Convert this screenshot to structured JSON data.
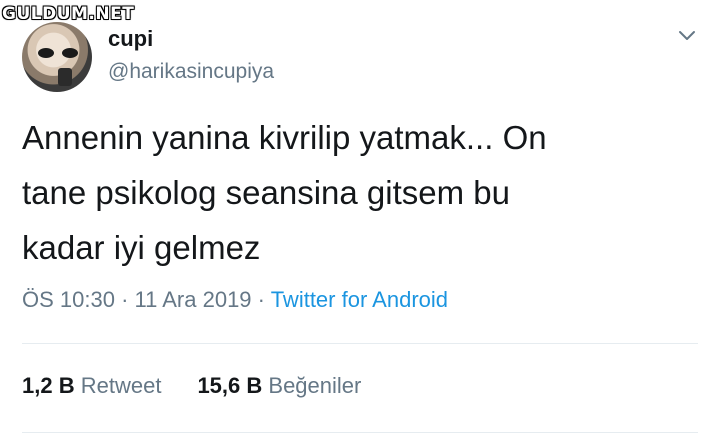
{
  "watermark": "GULDUM.NET",
  "user": {
    "name": "cupi",
    "handle": "@harikasincupiya"
  },
  "tweet": {
    "lines": [
      "Annenin yanina kivrilip yatmak... On",
      "tane psikolog seansina gitsem bu",
      "kadar iyi gelmez"
    ]
  },
  "meta": {
    "time": "ÖS 10:30",
    "dot1": " · ",
    "date": "11 Ara 2019",
    "dot2": " · ",
    "source": "Twitter for Android"
  },
  "stats": {
    "retweets_count": "1,2 B",
    "retweets_label": "Retweet",
    "likes_count": "15,6 B",
    "likes_label": "Beğeniler"
  },
  "colors": {
    "text": "#14171a",
    "secondary": "#657786",
    "link": "#1b95e0",
    "divider": "#e6ecf0"
  },
  "icons": {
    "menu": "chevron-down-icon"
  }
}
